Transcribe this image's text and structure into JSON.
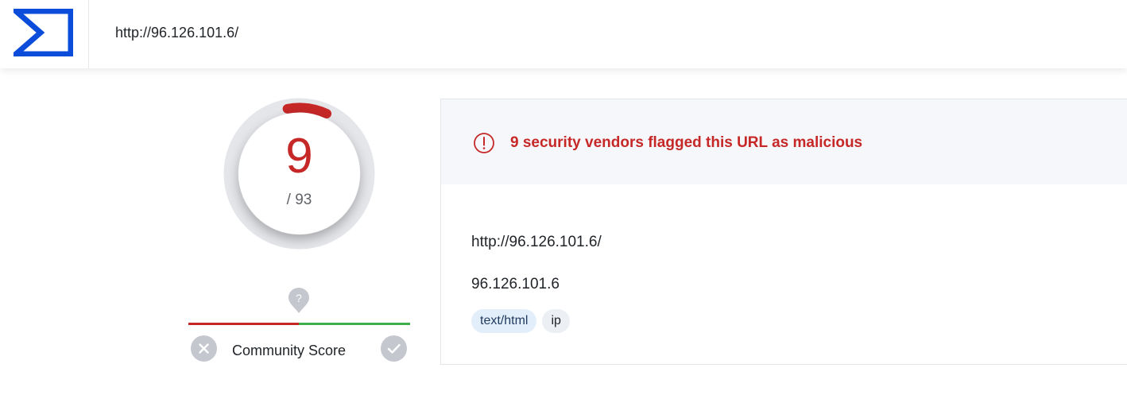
{
  "header": {
    "logo_icon": "sigma-logo-icon",
    "search_value": "http://96.126.101.6/",
    "brand_color": "#0b4dda"
  },
  "score": {
    "value": "9",
    "total": "/ 93",
    "malicious_fraction": 0.097,
    "alert_color": "#c62828"
  },
  "community": {
    "label": "Community Score",
    "help_icon": "question-icon",
    "down_icon": "close-icon",
    "up_icon": "check-icon"
  },
  "summary": {
    "alert_icon": "exclamation-circle-icon",
    "alert_text": "9 security vendors flagged this URL as malicious",
    "url": "http://96.126.101.6/",
    "host": "96.126.101.6",
    "tags": [
      {
        "label": "text/html",
        "style": "blue"
      },
      {
        "label": "ip",
        "style": "gray"
      }
    ]
  }
}
